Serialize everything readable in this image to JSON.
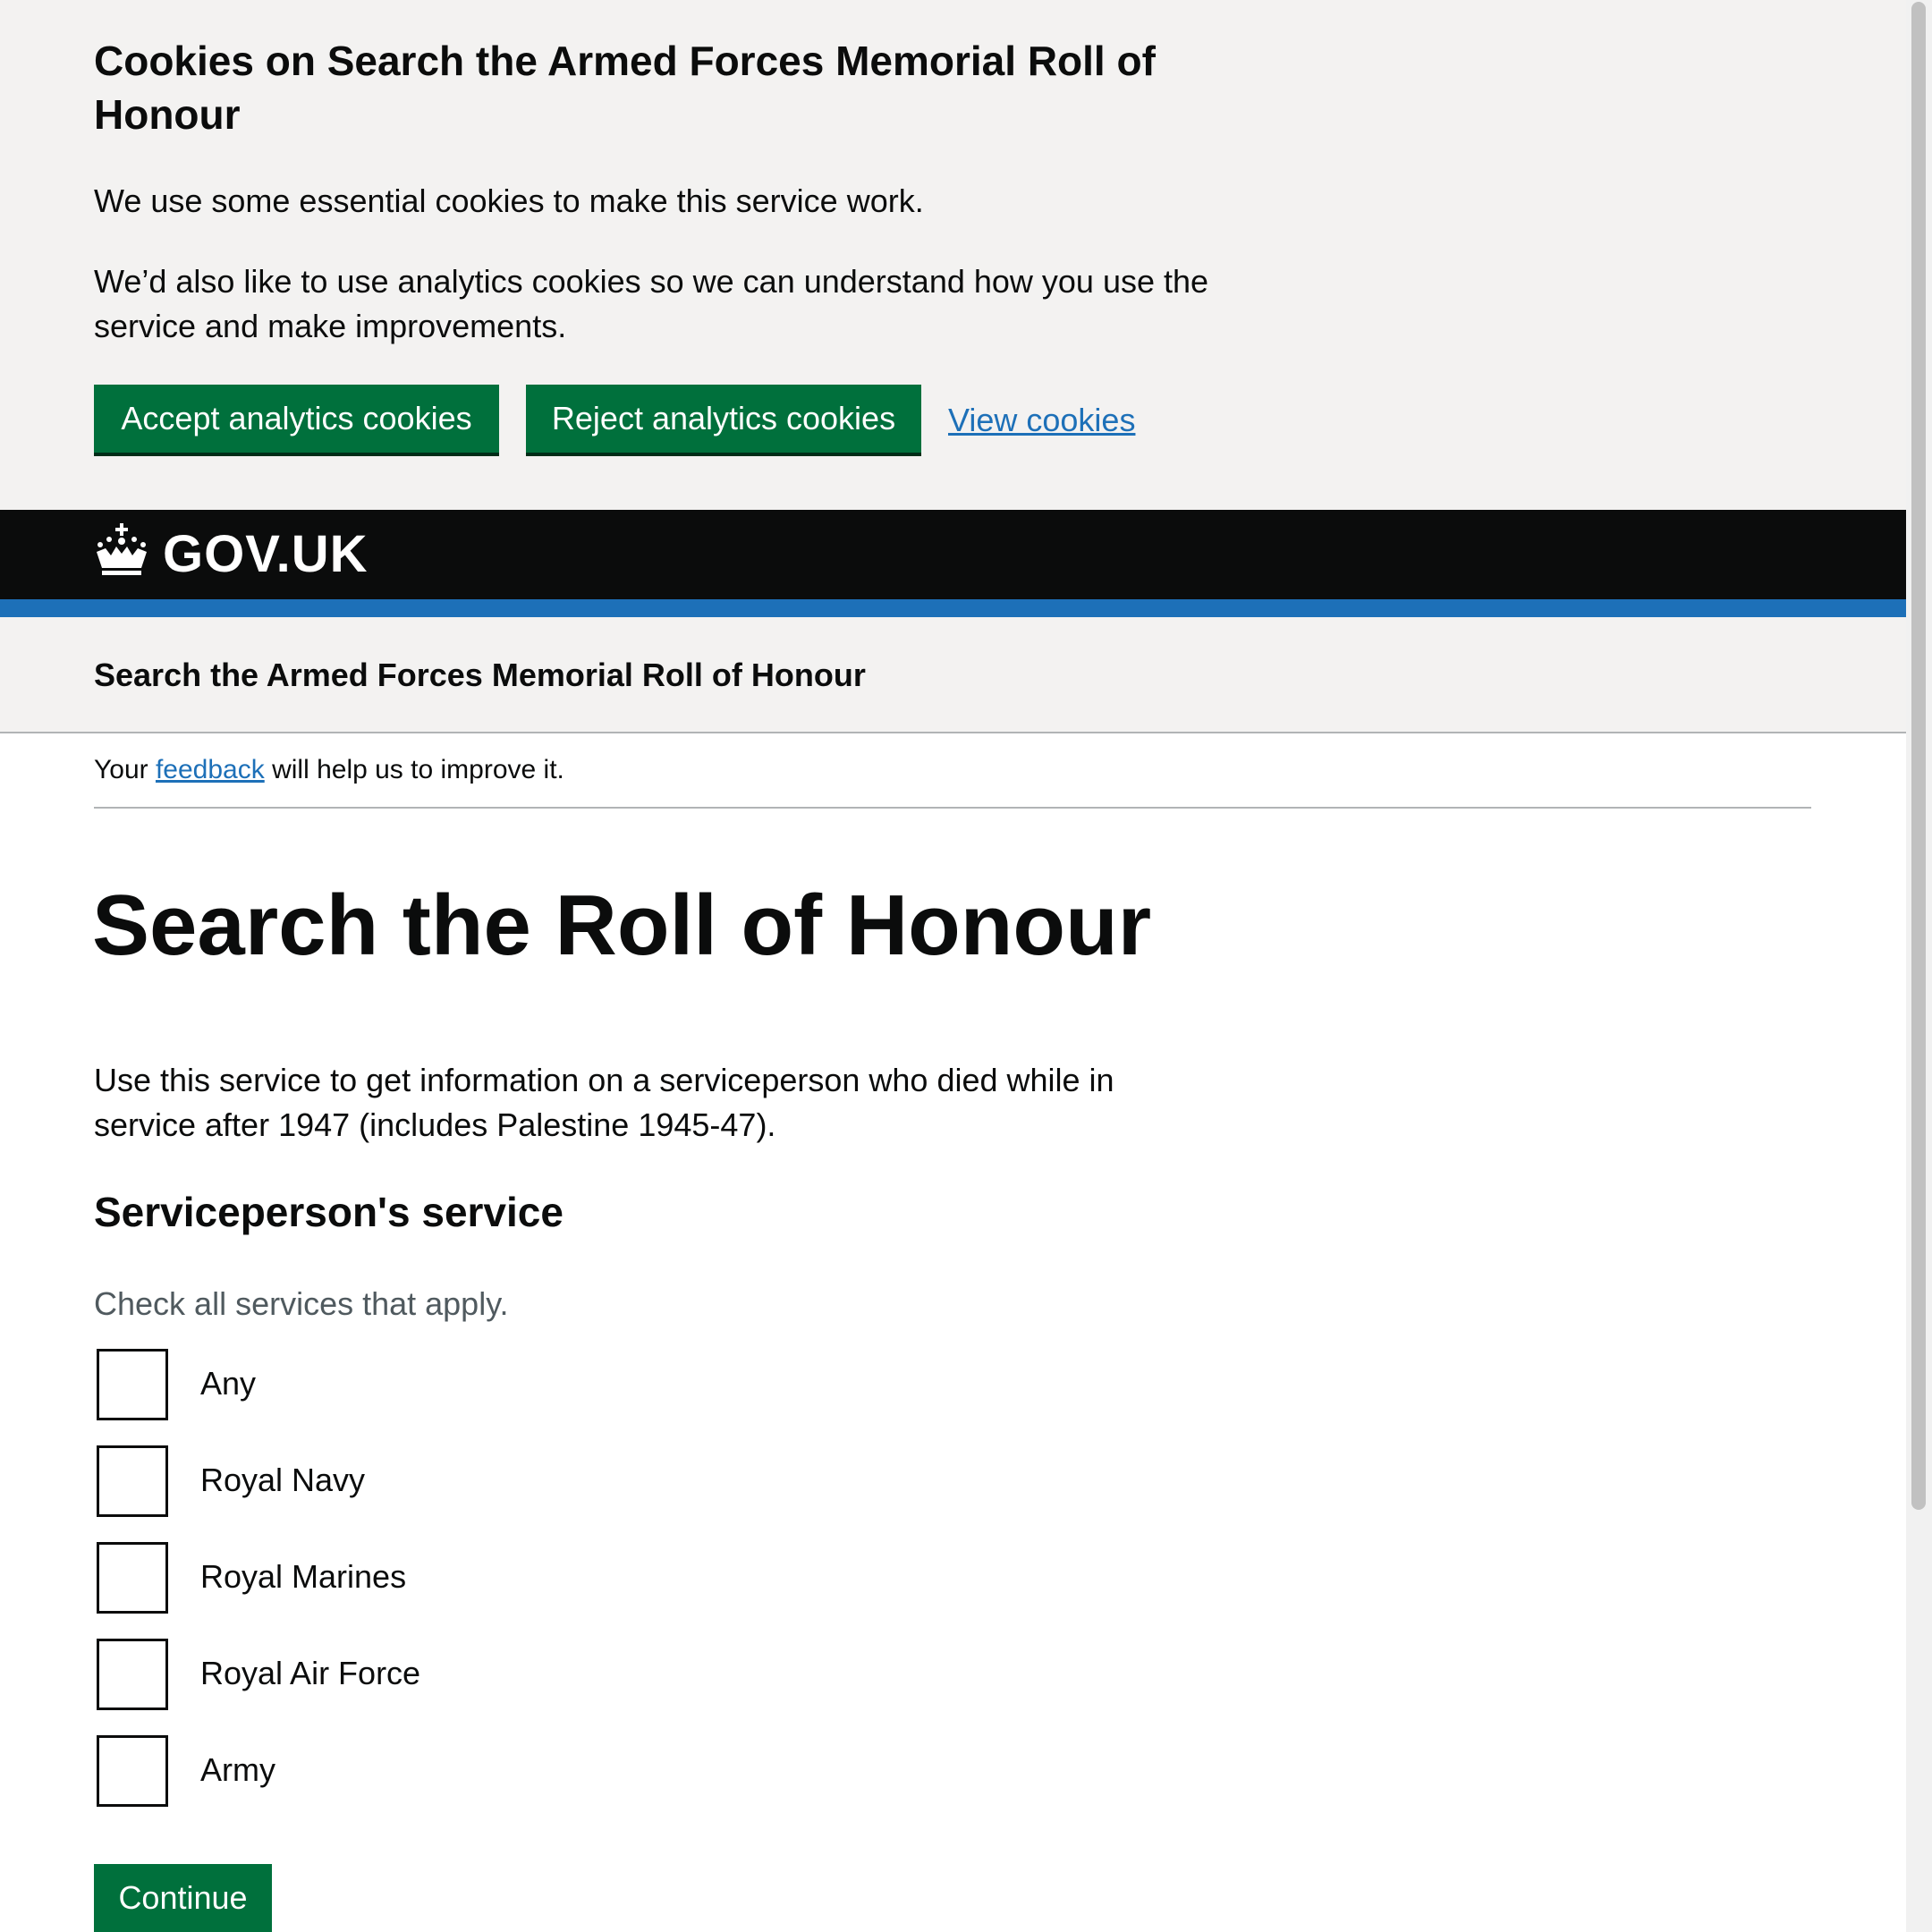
{
  "cookie_banner": {
    "heading": "Cookies on Search the Armed Forces Memorial Roll of Honour",
    "text_essential": "We use some essential cookies to make this service work.",
    "text_analytics": "We’d also like to use analytics cookies so we can understand how you use the service and make improvements.",
    "accept_label": "Accept analytics cookies",
    "reject_label": "Reject analytics cookies",
    "view_label": "View cookies"
  },
  "header": {
    "logo_text": "GOV.UK",
    "logo_icon": "crown-icon",
    "service_name": "Search the Armed Forces Memorial Roll of Honour"
  },
  "feedback": {
    "prefix": "Your",
    "link": "feedback",
    "suffix": "will help us to improve it."
  },
  "main": {
    "title": "Search the Roll of Honour",
    "intro": "Use this service to get information on a serviceperson who died while in service after 1947 (includes Palestine 1945-47).",
    "legend": "Serviceperson's service",
    "hint": "Check all services that apply.",
    "options": [
      {
        "label": "Any",
        "checked": false
      },
      {
        "label": "Royal Navy",
        "checked": false
      },
      {
        "label": "Royal Marines",
        "checked": false
      },
      {
        "label": "Royal Air Force",
        "checked": false
      },
      {
        "label": "Army",
        "checked": false
      }
    ],
    "continue_label": "Continue"
  },
  "colors": {
    "button_green": "#00703c",
    "link_blue": "#1d70b8",
    "header_black": "#0b0c0c",
    "banner_grey": "#f3f2f1"
  }
}
